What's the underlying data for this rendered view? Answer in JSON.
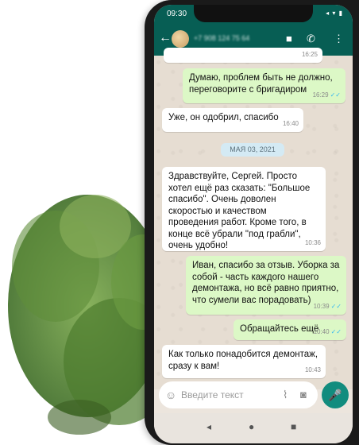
{
  "status": {
    "time": "09:30",
    "icons": "◂ ▾ ▮"
  },
  "appbar": {
    "back": "←",
    "phone": "+7 908 124 75 64",
    "video": "■",
    "call": "✆",
    "menu": "⋮"
  },
  "messages": [
    {
      "dir": "out",
      "text": "Думаю, проблем быть не должно, переговорите с бригадиром",
      "time": "16:29",
      "ticks": "✓✓"
    },
    {
      "dir": "in",
      "text": "Уже, он одобрил, спасибо",
      "time": "16:40"
    },
    {
      "dir": "in",
      "text": "Здравствуйте, Сергей. Просто хотел ещё раз сказать: \"Большое спасибо\". Очень доволен скоростью и качеством проведения работ. Кроме того, в конце всё убрали \"под грабли\", очень удобно!",
      "time": "10:36"
    },
    {
      "dir": "out",
      "text": "Иван, спасибо за отзыв. Уборка за собой - часть каждого нашего демонтажа, но всё равно приятно, что сумели вас порадовать)",
      "time": "10:39",
      "ticks": "✓✓"
    },
    {
      "dir": "out",
      "text": "Обращайтесь ещё",
      "time": "10:40",
      "ticks": "✓✓"
    },
    {
      "dir": "in",
      "text": "Как только понадобится демонтаж, сразу к вам!",
      "time": "10:43"
    }
  ],
  "partial_time": "16:25",
  "date_chip": "МАЯ 03, 2021",
  "input": {
    "placeholder": "Введите текст",
    "emoji": "☺",
    "attach": "⌇",
    "camera": "◙",
    "mic": "🎤"
  },
  "navbar": {
    "back": "◂",
    "home": "●",
    "recent": "■"
  }
}
